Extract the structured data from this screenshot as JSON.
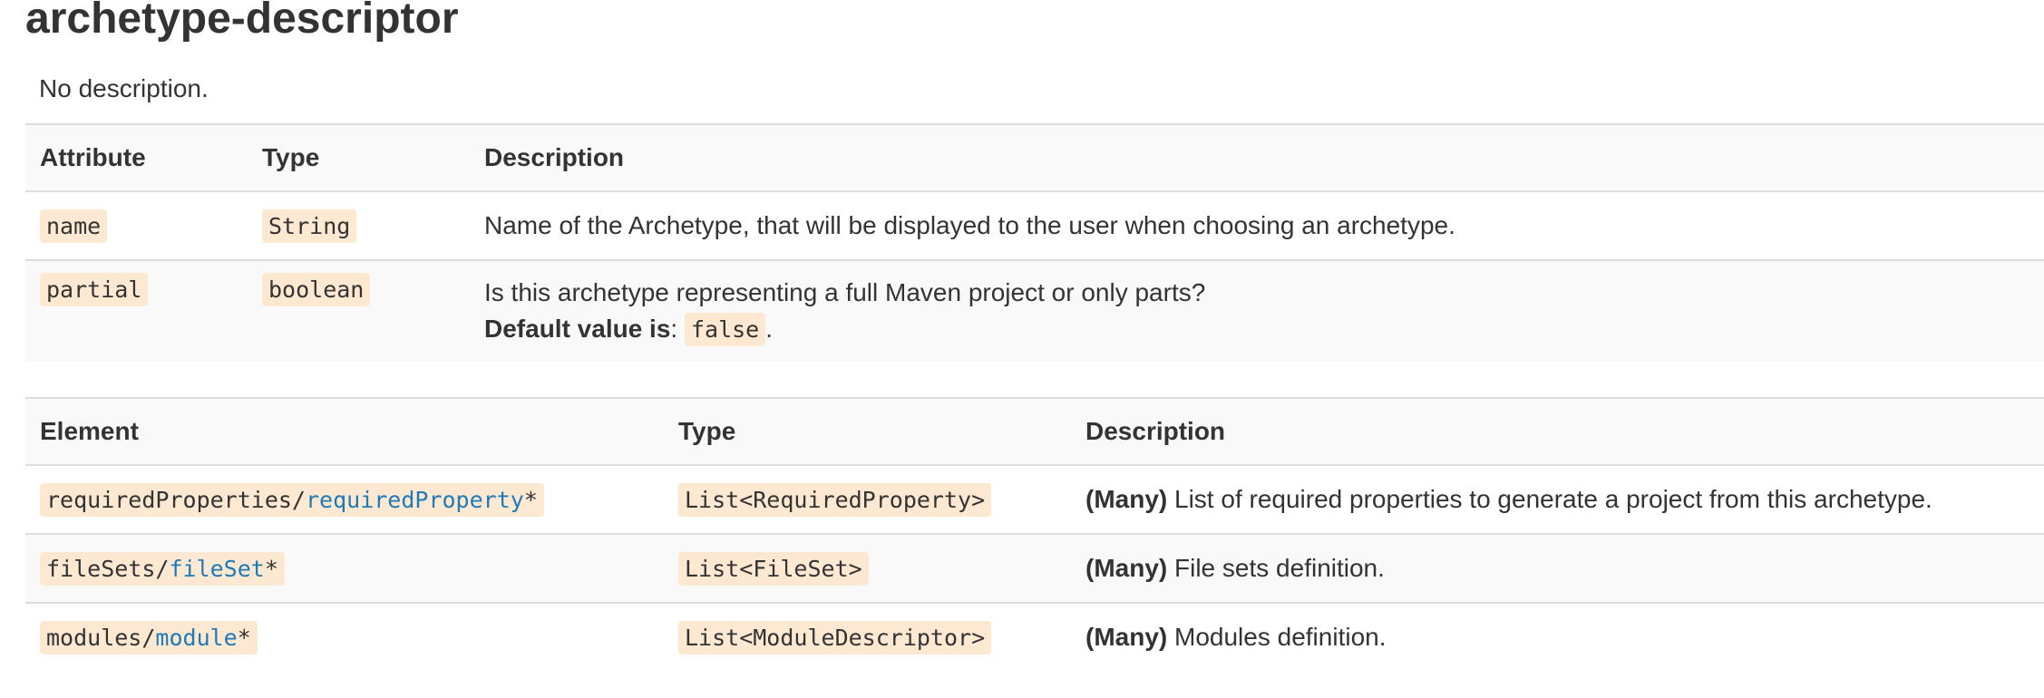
{
  "title": "archetype-descriptor",
  "description": "No description.",
  "attributes_table": {
    "headers": [
      "Attribute",
      "Type",
      "Description"
    ],
    "rows": [
      {
        "name": "name",
        "type": "String",
        "description": "Name of the Archetype, that will be displayed to the user when choosing an archetype."
      },
      {
        "name": "partial",
        "type": "boolean",
        "description": "Is this archetype representing a full Maven project or only parts?",
        "default_label": "Default value is",
        "default_sep": ":",
        "default_value": "false",
        "default_end": "."
      }
    ]
  },
  "elements_table": {
    "headers": [
      "Element",
      "Type",
      "Description"
    ],
    "rows": [
      {
        "prefix": "requiredProperties/",
        "link": "requiredProperty",
        "suffix": "*",
        "type": "List<RequiredProperty>",
        "many": "(Many)",
        "description": "List of required properties to generate a project from this archetype."
      },
      {
        "prefix": "fileSets/",
        "link": "fileSet",
        "suffix": "*",
        "type": "List<FileSet>",
        "many": "(Many)",
        "description": "File sets definition."
      },
      {
        "prefix": "modules/",
        "link": "module",
        "suffix": "*",
        "type": "List<ModuleDescriptor>",
        "many": "(Many)",
        "description": "Modules definition."
      }
    ]
  },
  "colors": {
    "text": "#333333",
    "link": "#1f7ab8",
    "code_bg": "#fde8d2",
    "stripe_bg": "#f9f9f9",
    "border": "#dddddd"
  }
}
